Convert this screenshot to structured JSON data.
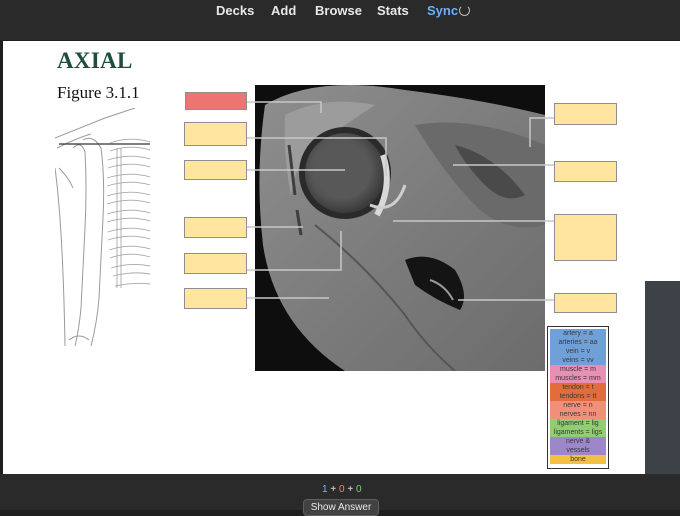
{
  "nav": {
    "decks": "Decks",
    "add": "Add",
    "browse": "Browse",
    "stats": "Stats",
    "sync": "Sync"
  },
  "card": {
    "title": "AXIAL",
    "figure": "Figure 3.1.1"
  },
  "legend": [
    {
      "text": "artery = a",
      "color": "#6fa0d8"
    },
    {
      "text": "arteries = aa",
      "color": "#6fa0d8"
    },
    {
      "text": "vein = v",
      "color": "#6fa0d8"
    },
    {
      "text": "veins = vv",
      "color": "#6fa0d8"
    },
    {
      "text": "muscle = m",
      "color": "#e78fb4"
    },
    {
      "text": "muscles = mm",
      "color": "#e78fb4"
    },
    {
      "text": "tendon = t",
      "color": "#e36c3c"
    },
    {
      "text": "tendons = tt",
      "color": "#e36c3c"
    },
    {
      "text": "nerve = n",
      "color": "#f0907a"
    },
    {
      "text": "nerves = nn",
      "color": "#f0907a"
    },
    {
      "text": "ligament = lig",
      "color": "#92cc73"
    },
    {
      "text": "ligaments = ligs",
      "color": "#92cc73"
    },
    {
      "text": "nerve &",
      "color": "#9d87c9"
    },
    {
      "text": "vessels",
      "color": "#9d87c9"
    },
    {
      "text": "bone",
      "color": "#f2c043"
    }
  ],
  "counts": {
    "new": "1",
    "plus1": "+",
    "learn": "0",
    "plus2": "+",
    "review": "0"
  },
  "show_answer": "Show Answer"
}
